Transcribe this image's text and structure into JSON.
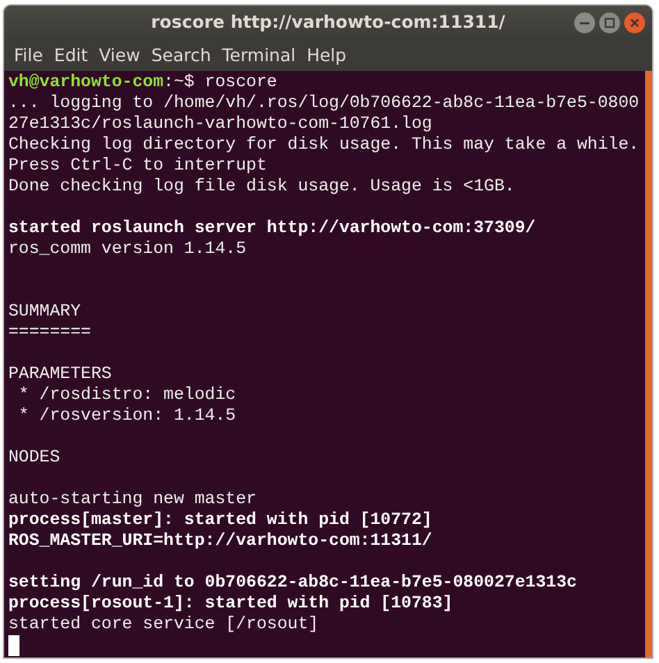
{
  "window": {
    "title": "roscore http://varhowto-com:11311/",
    "controls": [
      {
        "kind": "minimize"
      },
      {
        "kind": "maximize"
      },
      {
        "kind": "close"
      }
    ]
  },
  "menu": [
    "File",
    "Edit",
    "View",
    "Search",
    "Terminal",
    "Help"
  ],
  "terminal": {
    "lines": [
      {
        "kind": "prompt",
        "user_host": "vh@varhowto-com",
        "path": ":~$",
        "command": "roscore"
      },
      {
        "kind": "text",
        "text": "... logging to /home/vh/.ros/log/0b706622-ab8c-11ea-b7e5-0800",
        "bold": false
      },
      {
        "kind": "text",
        "text": "27e1313c/roslaunch-varhowto-com-10761.log",
        "bold": false
      },
      {
        "kind": "text",
        "text": "Checking log directory for disk usage. This may take a while.",
        "bold": false
      },
      {
        "kind": "text",
        "text": "Press Ctrl-C to interrupt",
        "bold": false
      },
      {
        "kind": "text",
        "text": "Done checking log file disk usage. Usage is <1GB.",
        "bold": false
      },
      {
        "kind": "blank"
      },
      {
        "kind": "text",
        "text": "started roslaunch server http://varhowto-com:37309/",
        "bold": true
      },
      {
        "kind": "text",
        "text": "ros_comm version 1.14.5",
        "bold": false
      },
      {
        "kind": "blank"
      },
      {
        "kind": "blank"
      },
      {
        "kind": "text",
        "text": "SUMMARY",
        "bold": false
      },
      {
        "kind": "text",
        "text": "========",
        "bold": false
      },
      {
        "kind": "blank"
      },
      {
        "kind": "text",
        "text": "PARAMETERS",
        "bold": false
      },
      {
        "kind": "text",
        "text": " * /rosdistro: melodic",
        "bold": false
      },
      {
        "kind": "text",
        "text": " * /rosversion: 1.14.5",
        "bold": false
      },
      {
        "kind": "blank"
      },
      {
        "kind": "text",
        "text": "NODES",
        "bold": false
      },
      {
        "kind": "blank"
      },
      {
        "kind": "text",
        "text": "auto-starting new master",
        "bold": false
      },
      {
        "kind": "text",
        "text": "process[master]: started with pid [10772]",
        "bold": true
      },
      {
        "kind": "text",
        "text": "ROS_MASTER_URI=http://varhowto-com:11311/",
        "bold": true
      },
      {
        "kind": "blank"
      },
      {
        "kind": "text",
        "text": "setting /run_id to 0b706622-ab8c-11ea-b7e5-080027e1313c",
        "bold": true
      },
      {
        "kind": "text",
        "text": "process[rosout-1]: started with pid [10783]",
        "bold": true
      },
      {
        "kind": "text",
        "text": "started core service [/rosout]",
        "bold": false
      },
      {
        "kind": "cursor"
      }
    ]
  }
}
